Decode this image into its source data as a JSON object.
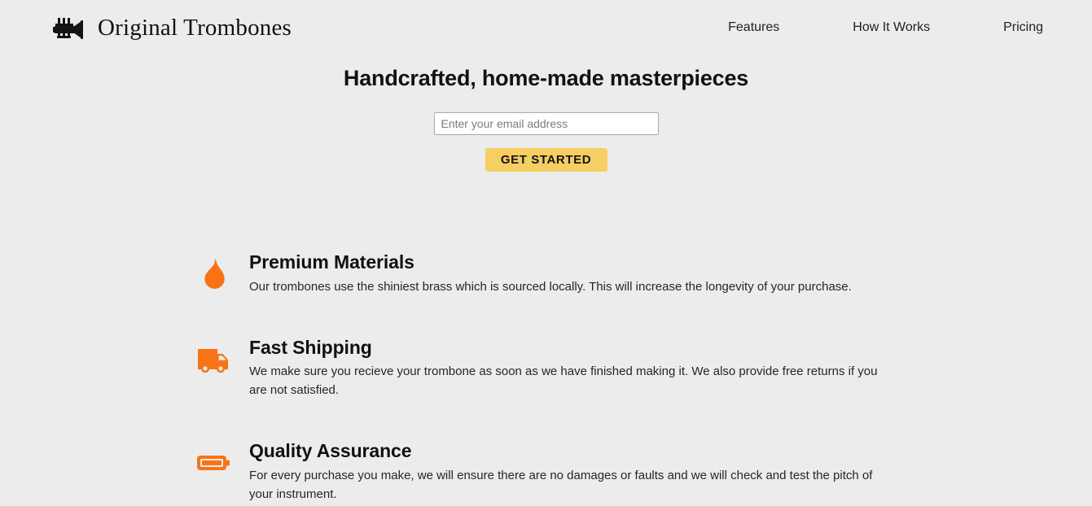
{
  "theme": {
    "page_background": "#ececec",
    "accent_button": "#f6ce63",
    "icon_orange": "#f97316",
    "text_primary": "#111111"
  },
  "header": {
    "logo_icon": "trumpet-icon",
    "brand_name": "Original Trombones",
    "nav": [
      {
        "label": "Features"
      },
      {
        "label": "How It Works"
      },
      {
        "label": "Pricing"
      }
    ]
  },
  "hero": {
    "title": "Handcrafted, home-made masterpieces",
    "email_placeholder": "Enter your email address",
    "email_value": "",
    "cta_label": "GET STARTED"
  },
  "features": [
    {
      "icon": "flame-icon",
      "title": "Premium Materials",
      "description": "Our trombones use the shiniest brass which is sourced locally. This will increase the longevity of your purchase."
    },
    {
      "icon": "delivery-truck-icon",
      "title": "Fast Shipping",
      "description": "We make sure you recieve your trombone as soon as we have finished making it. We also provide free returns if you are not satisfied."
    },
    {
      "icon": "battery-full-icon",
      "title": "Quality Assurance",
      "description": "For every purchase you make, we will ensure there are no damages or faults and we will check and test the pitch of your instrument."
    }
  ]
}
